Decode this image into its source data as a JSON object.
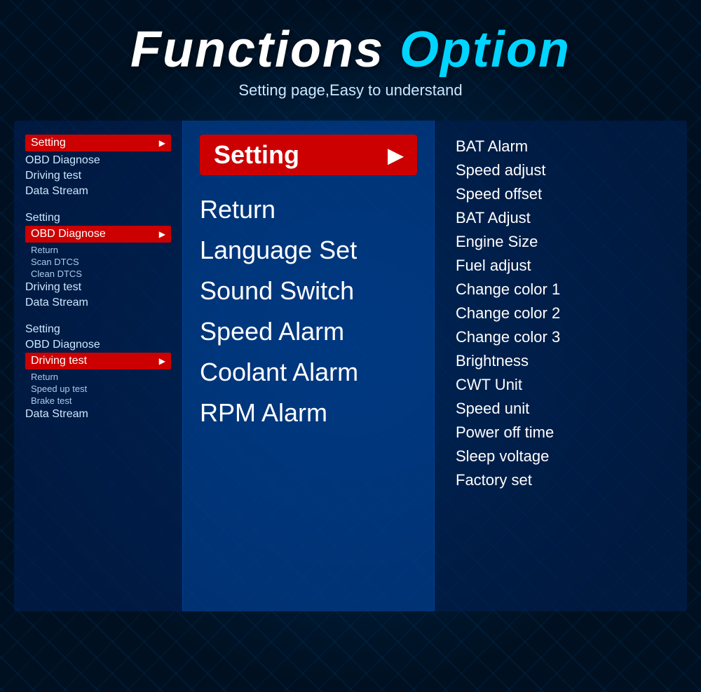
{
  "header": {
    "title_part1": "Functions ",
    "title_part2": "Option",
    "subtitle": "Setting page,Easy to understand"
  },
  "left_panel": {
    "groups": [
      {
        "items": [
          {
            "label": "Setting",
            "active": true,
            "has_arrow": true
          },
          {
            "label": "OBD Diagnose",
            "active": false
          },
          {
            "label": "Driving test",
            "active": false
          },
          {
            "label": "Data Stream",
            "active": false
          }
        ]
      },
      {
        "items": [
          {
            "label": "Setting",
            "active": false
          },
          {
            "label": "OBD Diagnose",
            "active": true,
            "has_arrow": true
          },
          {
            "label": "Return",
            "sub": true
          },
          {
            "label": "Scan DTCS",
            "sub": true
          },
          {
            "label": "Clean DTCS",
            "sub": true
          },
          {
            "label": "Driving test",
            "active": false
          },
          {
            "label": "Data Stream",
            "active": false
          }
        ]
      },
      {
        "items": [
          {
            "label": "Setting",
            "active": false
          },
          {
            "label": "OBD Diagnose",
            "active": false
          },
          {
            "label": "Driving test",
            "active": true,
            "has_arrow": true
          },
          {
            "label": "Return",
            "sub": true
          },
          {
            "label": "Speed up test",
            "sub": true
          },
          {
            "label": "Brake test",
            "sub": true
          },
          {
            "label": "Data Stream",
            "active": false
          }
        ]
      }
    ]
  },
  "center_panel": {
    "active_item": "Setting",
    "menu_items": [
      "Return",
      "Language Set",
      "Sound Switch",
      "Speed Alarm",
      "Coolant Alarm",
      "RPM Alarm"
    ]
  },
  "right_panel": {
    "menu_items": [
      "BAT Alarm",
      "Speed adjust",
      "Speed offset",
      "BAT Adjust",
      "Engine Size",
      "Fuel adjust",
      "Change color 1",
      "Change color 2",
      "Change color 3",
      "Brightness",
      "CWT Unit",
      "Speed unit",
      "Power off time",
      "Sleep voltage",
      "Factory set"
    ]
  }
}
